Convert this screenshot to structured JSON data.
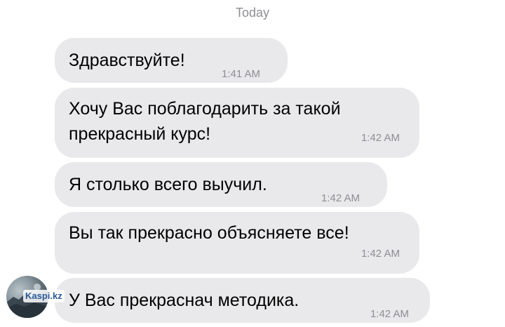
{
  "chat": {
    "day_header": "Today",
    "messages": [
      {
        "text": "Здравствуйте!",
        "time": "1:41 AM"
      },
      {
        "text": "Хочу Вас поблагодарить за такой\nпрекрасный курс!",
        "time": "1:42 AM"
      },
      {
        "text": "Я столько всего выучил.",
        "time": "1:42 AM"
      },
      {
        "text": "Вы так прекрасно объясняете все!",
        "time": "1:42 AM"
      },
      {
        "text": "У Вас прекраснач методика.",
        "time": "1:42 AM"
      }
    ]
  },
  "watermark": {
    "text": "Kaspi.kz"
  },
  "colors": {
    "bubble_bg": "#e9e9eb",
    "text": "#000000",
    "meta_text": "#8e8e93",
    "background": "#ffffff"
  }
}
